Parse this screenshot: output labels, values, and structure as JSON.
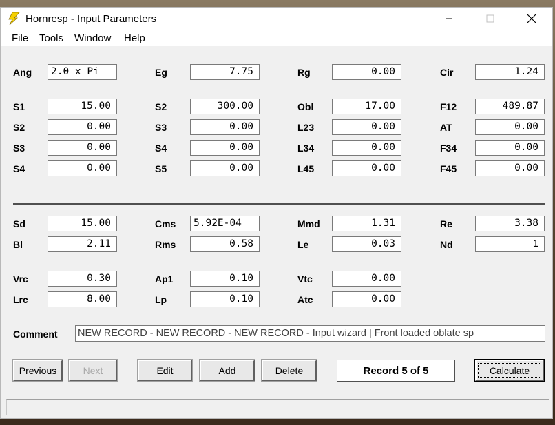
{
  "window": {
    "title": "Hornresp - Input Parameters"
  },
  "menu": [
    "File",
    "Tools",
    "Window",
    "Help"
  ],
  "fields": {
    "Ang": "2.0 x Pi",
    "Eg": "7.75",
    "Rg": "0.00",
    "Cir": "1.24",
    "S1": "15.00",
    "S2a": "300.00",
    "Obl": "17.00",
    "F12": "489.87",
    "S2": "0.00",
    "S3a": "0.00",
    "L23": "0.00",
    "AT": "0.00",
    "S3": "0.00",
    "S4a": "0.00",
    "L34": "0.00",
    "F34": "0.00",
    "S4": "0.00",
    "S5": "0.00",
    "L45": "0.00",
    "F45": "0.00",
    "Sd": "15.00",
    "Cms": "5.92E-04",
    "Mmd": "1.31",
    "Re": "3.38",
    "Bl": "2.11",
    "Rms": "0.58",
    "Le": "0.03",
    "Nd": "1",
    "Vrc": "0.30",
    "Ap1": "0.10",
    "Vtc": "0.00",
    "Lrc": "8.00",
    "Lp": "0.10",
    "Atc": "0.00"
  },
  "labels": {
    "Ang": "Ang",
    "Eg": "Eg",
    "Rg": "Rg",
    "Cir": "Cir",
    "S1": "S1",
    "S2a": "S2",
    "Obl": "Obl",
    "F12": "F12",
    "S2": "S2",
    "S3a": "S3",
    "L23": "L23",
    "AT": "AT",
    "S3": "S3",
    "S4a": "S4",
    "L34": "L34",
    "F34": "F34",
    "S4": "S4",
    "S5": "S5",
    "L45": "L45",
    "F45": "F45",
    "Sd": "Sd",
    "Cms": "Cms",
    "Mmd": "Mmd",
    "Re": "Re",
    "Bl": "Bl",
    "Rms": "Rms",
    "Le": "Le",
    "Nd": "Nd",
    "Vrc": "Vrc",
    "Ap1": "Ap1",
    "Vtc": "Vtc",
    "Lrc": "Lrc",
    "Lp": "Lp",
    "Atc": "Atc"
  },
  "comment": {
    "label": "Comment",
    "value": "NEW RECORD - NEW RECORD - NEW RECORD - Input wizard | Front loaded oblate sp"
  },
  "buttons": {
    "previous": "Previous",
    "next": "Next",
    "edit": "Edit",
    "add": "Add",
    "delete": "Delete",
    "calculate": "Calculate"
  },
  "record": "Record 5 of 5",
  "colors": {
    "window_bg": "#f0f0f0",
    "title_bg": "#ffffff",
    "icon_yellow": "#f5d000"
  }
}
